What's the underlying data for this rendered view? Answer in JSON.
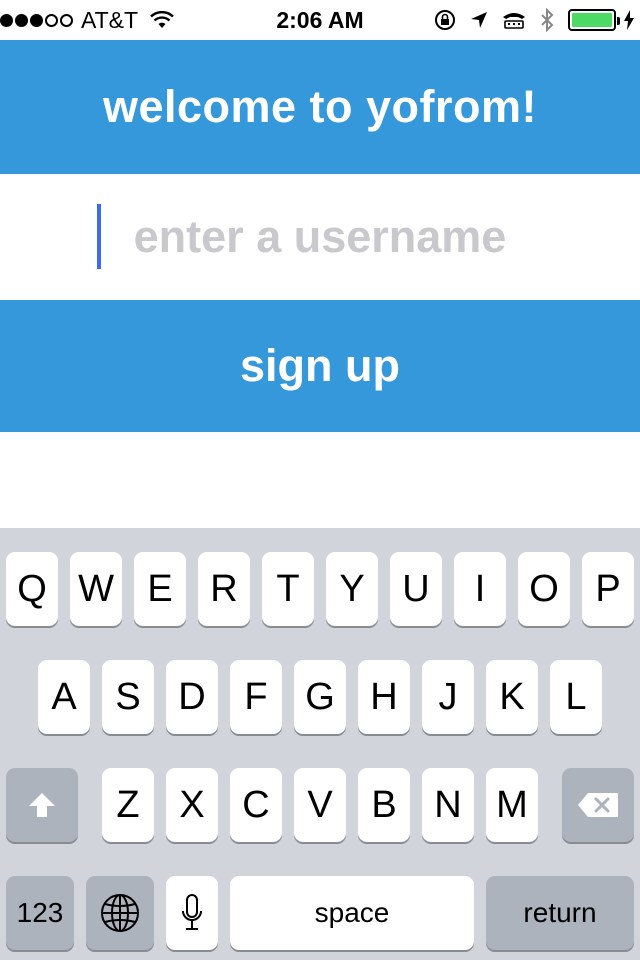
{
  "status_bar": {
    "carrier": "AT&T",
    "time": "2:06 AM",
    "signal_bars_filled": 3,
    "signal_bars_total": 5,
    "battery_color": "#4cd964"
  },
  "header": {
    "title": "welcome to yofrom!"
  },
  "username": {
    "placeholder": "enter a username",
    "value": ""
  },
  "signup": {
    "label": "sign up"
  },
  "colors": {
    "accent": "#3498db",
    "keyboard_bg": "#d1d5db",
    "dark_key": "#acb3bd"
  },
  "keyboard": {
    "row1": [
      "Q",
      "W",
      "E",
      "R",
      "T",
      "Y",
      "U",
      "I",
      "O",
      "P"
    ],
    "row2": [
      "A",
      "S",
      "D",
      "F",
      "G",
      "H",
      "J",
      "K",
      "L"
    ],
    "row3": [
      "Z",
      "X",
      "C",
      "V",
      "B",
      "N",
      "M"
    ],
    "shift_icon": "shift-icon",
    "delete_icon": "delete-icon",
    "numbers_label": "123",
    "globe_icon": "globe-icon",
    "mic_icon": "microphone-icon",
    "space_label": "space",
    "return_label": "return"
  }
}
